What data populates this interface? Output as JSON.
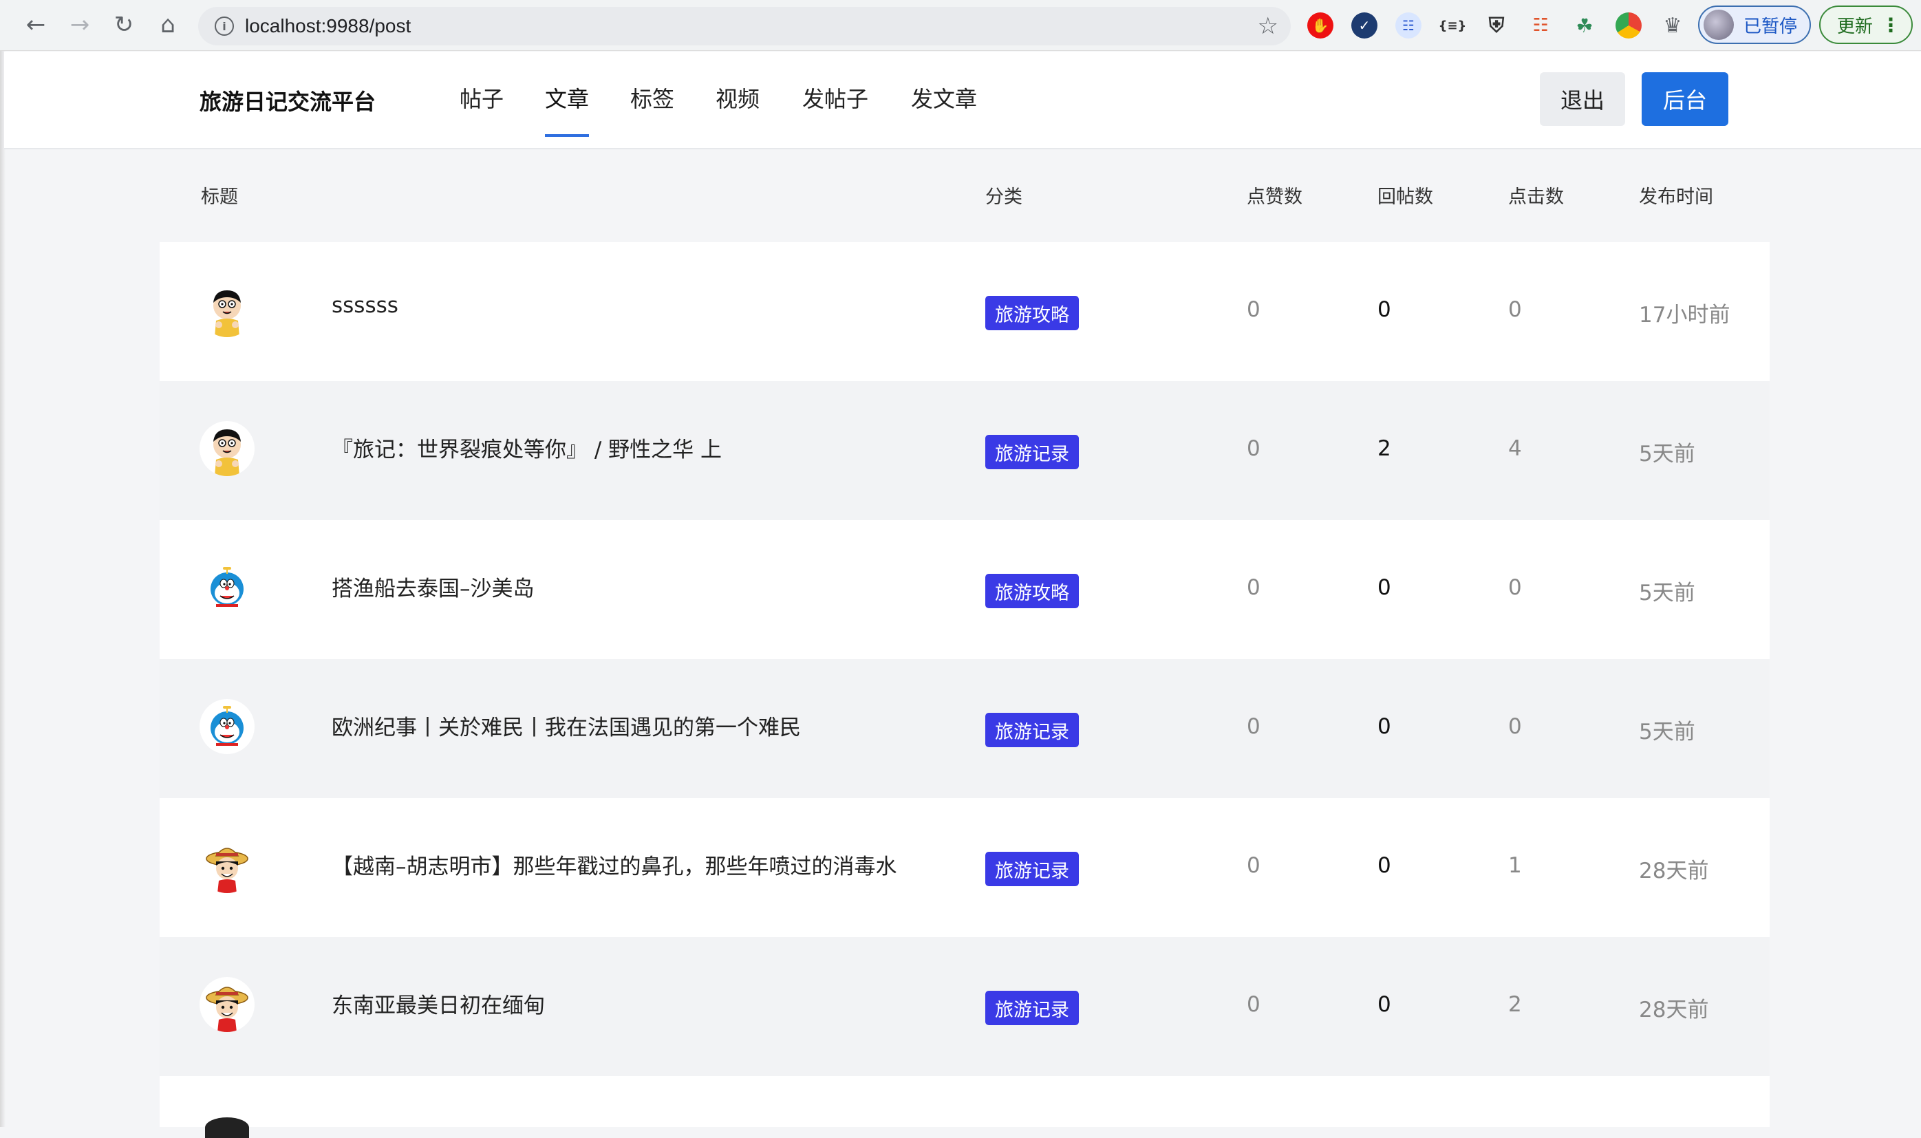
{
  "browser": {
    "url": "localhost:9988/post",
    "profile_label": "已暂停",
    "update_label": "更新",
    "update_menu": "⋮"
  },
  "nav": {
    "brand": "旅游日记交流平台",
    "tabs": [
      {
        "label": "帖子"
      },
      {
        "label": "文章"
      },
      {
        "label": "标签"
      },
      {
        "label": "视频"
      },
      {
        "label": "发帖子"
      },
      {
        "label": "发文章"
      }
    ],
    "active_tab": "文章",
    "logout_label": "退出",
    "admin_label": "后台"
  },
  "table": {
    "headers": {
      "title": "标题",
      "category": "分类",
      "likes": "点赞数",
      "replies": "回帖数",
      "clicks": "点击数",
      "time": "发布时间"
    },
    "rows": [
      {
        "avatar": "nobita",
        "title": "ssssss",
        "category": "旅游攻略",
        "likes": "0",
        "replies": "0",
        "clicks": "0",
        "time": "17小时前"
      },
      {
        "avatar": "nobita",
        "title": "『旅记：世界裂痕处等你』 / 野性之华 上",
        "category": "旅游记录",
        "likes": "0",
        "replies": "2",
        "clicks": "4",
        "time": "5天前"
      },
      {
        "avatar": "doraemon",
        "title": "搭渔船去泰国–沙美岛",
        "category": "旅游攻略",
        "likes": "0",
        "replies": "0",
        "clicks": "0",
        "time": "5天前"
      },
      {
        "avatar": "doraemon",
        "title": "欧洲纪事丨关於难民丨我在法国遇见的第一个难民",
        "category": "旅游记录",
        "likes": "0",
        "replies": "0",
        "clicks": "0",
        "time": "5天前"
      },
      {
        "avatar": "luffy",
        "title": "【越南–胡志明市】那些年戳过的鼻孔，那些年喷过的消毒水",
        "category": "旅游记录",
        "likes": "0",
        "replies": "0",
        "clicks": "1",
        "time": "28天前"
      },
      {
        "avatar": "luffy",
        "title": "东南亚最美日初在缅甸",
        "category": "旅游记录",
        "likes": "0",
        "replies": "0",
        "clicks": "2",
        "time": "28天前"
      }
    ]
  },
  "colors": {
    "accent": "#1e6fe0",
    "badge": "#3a3ae6",
    "row_alt": "#f2f3f5"
  }
}
